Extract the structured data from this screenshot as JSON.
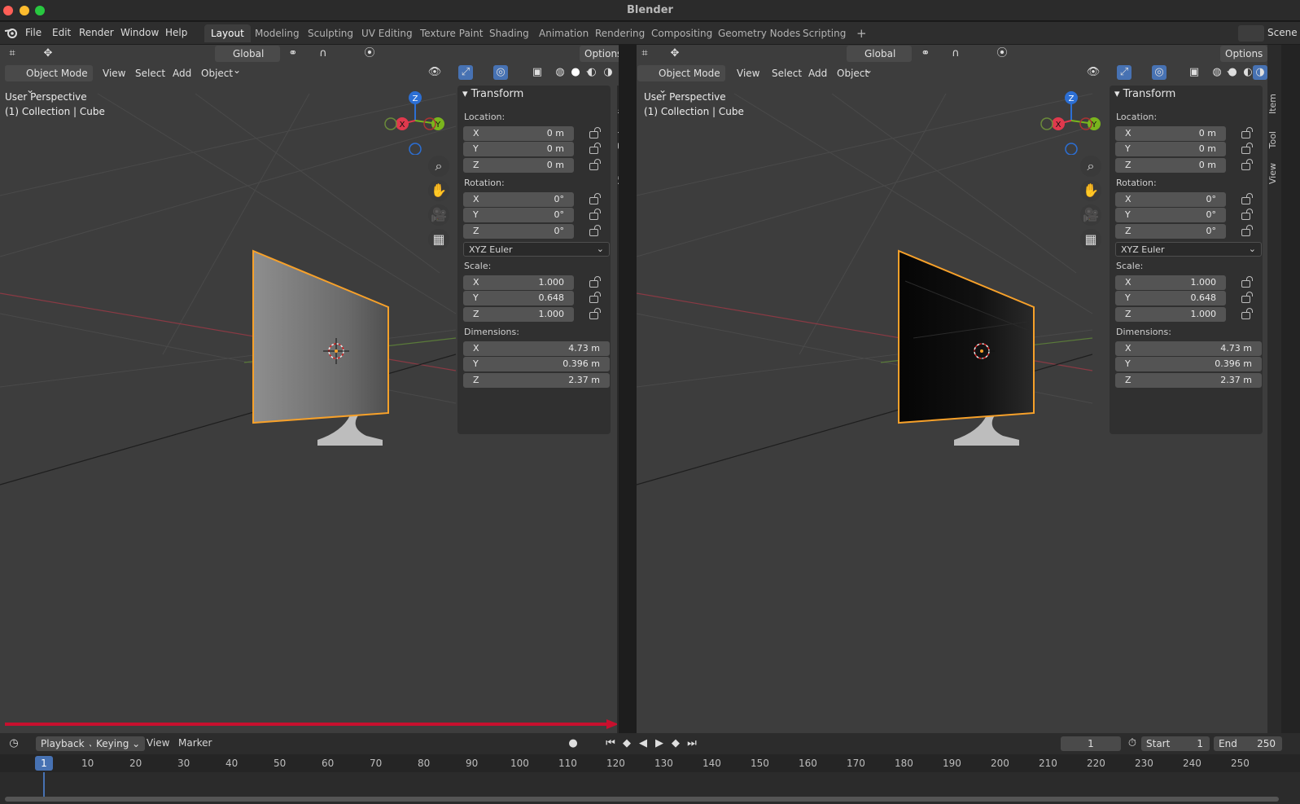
{
  "window": {
    "title": "Blender"
  },
  "menu": [
    "File",
    "Edit",
    "Render",
    "Window",
    "Help"
  ],
  "workspace_tabs": [
    "Layout",
    "Modeling",
    "Sculpting",
    "UV Editing",
    "Texture Paint",
    "Shading",
    "Animation",
    "Rendering",
    "Compositing",
    "Geometry Nodes",
    "Scripting"
  ],
  "active_tab": "Layout",
  "scene_label": "Scene",
  "viewport_header": {
    "orientation": "Global",
    "options": "Options",
    "mode": "Object Mode",
    "view": "View",
    "select": "Select",
    "add": "Add",
    "object": "Object"
  },
  "viewport_info": {
    "perspective": "User Perspective",
    "collection": "(1) Collection | Cube"
  },
  "gizmo": {
    "z": "Z",
    "x": "X",
    "y": "Y"
  },
  "npanel": {
    "title": "Transform",
    "location_label": "Location:",
    "location": [
      {
        "axis": "X",
        "value": "0 m"
      },
      {
        "axis": "Y",
        "value": "0 m"
      },
      {
        "axis": "Z",
        "value": "0 m"
      }
    ],
    "rotation_label": "Rotation:",
    "rotation": [
      {
        "axis": "X",
        "value": "0°"
      },
      {
        "axis": "Y",
        "value": "0°"
      },
      {
        "axis": "Z",
        "value": "0°"
      }
    ],
    "rotation_mode": "XYZ Euler",
    "scale_label": "Scale:",
    "scale": [
      {
        "axis": "X",
        "value": "1.000"
      },
      {
        "axis": "Y",
        "value": "0.648"
      },
      {
        "axis": "Z",
        "value": "1.000"
      }
    ],
    "dimensions_label": "Dimensions:",
    "dimensions": [
      {
        "axis": "X",
        "value": "4.73 m"
      },
      {
        "axis": "Y",
        "value": "0.396 m"
      },
      {
        "axis": "Z",
        "value": "2.37 m"
      }
    ],
    "tabs": [
      "Item",
      "Tool",
      "View"
    ]
  },
  "timeline": {
    "playback": "Playback",
    "keying": "Keying",
    "view": "View",
    "marker": "Marker",
    "current_frame": "1",
    "start_label": "Start",
    "start": "1",
    "end_label": "End",
    "end": "250",
    "ruler": [
      "10",
      "20",
      "30",
      "40",
      "50",
      "60",
      "70",
      "80",
      "90",
      "100",
      "110",
      "120",
      "130",
      "140",
      "150",
      "160",
      "170",
      "180",
      "190",
      "200",
      "210",
      "220",
      "230",
      "240",
      "250"
    ]
  },
  "colors": {
    "accent": "#4772b3",
    "selection_outline": "#f7a12a",
    "x_axis": "#e0394d",
    "y_axis": "#7ab51d",
    "z_axis": "#2c6fd4",
    "red_annotation": "#c8102e"
  }
}
